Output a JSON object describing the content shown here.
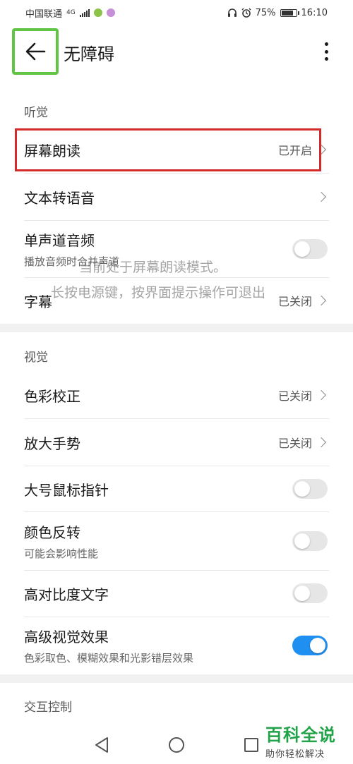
{
  "status_bar": {
    "carrier": "中国联通",
    "network": "4G",
    "battery_pct": "75%",
    "battery_level": 0.75,
    "time": "16:10",
    "icons": [
      "signal-icon",
      "app-icon-green",
      "app-icon-purple",
      "headset-icon",
      "alarm-icon",
      "battery-icon"
    ]
  },
  "header": {
    "title": "无障碍",
    "back_icon": "arrow-left-icon",
    "more_icon": "more-vertical-icon"
  },
  "sections": {
    "hearing": "听觉",
    "vision": "视觉",
    "interaction": "交互控制"
  },
  "items": {
    "screen_reader": {
      "title": "屏幕朗读",
      "value": "已开启"
    },
    "tts": {
      "title": "文本转语音"
    },
    "mono_audio": {
      "title": "单声道音频",
      "sub": "播放音频时合并声道",
      "toggle": false
    },
    "captions": {
      "title": "字幕",
      "value": "已关闭"
    },
    "color_correction": {
      "title": "色彩校正",
      "value": "已关闭"
    },
    "magnification": {
      "title": "放大手势",
      "value": "已关闭"
    },
    "large_pointer": {
      "title": "大号鼠标指针",
      "toggle": false
    },
    "color_inversion": {
      "title": "颜色反转",
      "sub": "可能会影响性能",
      "toggle": false
    },
    "high_contrast": {
      "title": "高对比度文字",
      "toggle": false
    },
    "advanced_visual": {
      "title": "高级视觉效果",
      "sub": "色彩取色、模糊效果和光影错层效果",
      "toggle": true
    }
  },
  "overlay": {
    "line1": "当前处于屏幕朗读模式。",
    "line2": "长按电源键，按界面提示操作可退出"
  },
  "watermark": {
    "title": "百科全说",
    "subtitle": "助你轻松解决"
  },
  "colors": {
    "accent": "#1f8ff1",
    "highlight_red": "#d32a2a",
    "highlight_green": "#62c445",
    "watermark_green": "#22a34a"
  }
}
